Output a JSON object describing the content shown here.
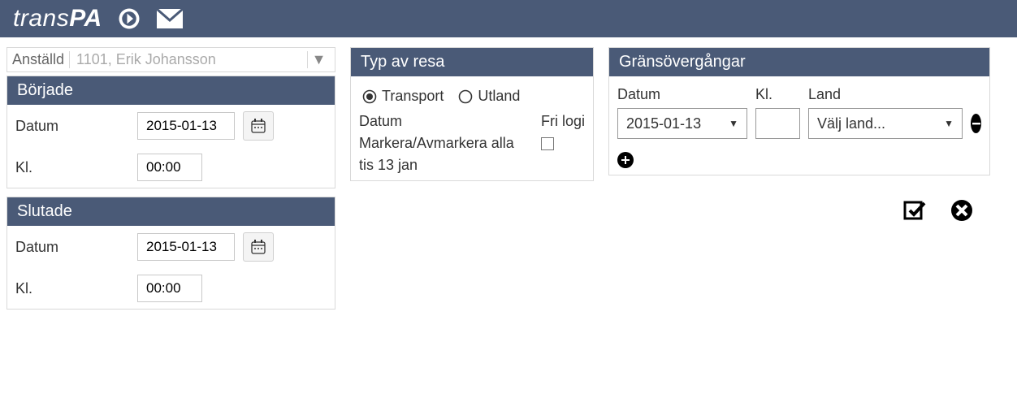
{
  "brand": {
    "prefix": "trans",
    "suffix": "PA"
  },
  "employee": {
    "label": "Anställd",
    "value": "1101, Erik  Johansson"
  },
  "started": {
    "title": "Började",
    "date_label": "Datum",
    "date_value": "2015-01-13",
    "time_label": "Kl.",
    "time_value": "00:00"
  },
  "ended": {
    "title": "Slutade",
    "date_label": "Datum",
    "date_value": "2015-01-13",
    "time_label": "Kl.",
    "time_value": "00:00"
  },
  "trip_type": {
    "title": "Typ av resa",
    "opt_transport": "Transport",
    "opt_utland": "Utland",
    "col_date": "Datum",
    "col_frilogi": "Fri logi",
    "mark_all": "Markera/Avmarkera alla",
    "row_date": "tis 13 jan"
  },
  "crossings": {
    "title": "Gränsövergångar",
    "col_date": "Datum",
    "col_time": "Kl.",
    "col_land": "Land",
    "row_date": "2015-01-13",
    "row_time": "",
    "row_land": "Välj land..."
  }
}
